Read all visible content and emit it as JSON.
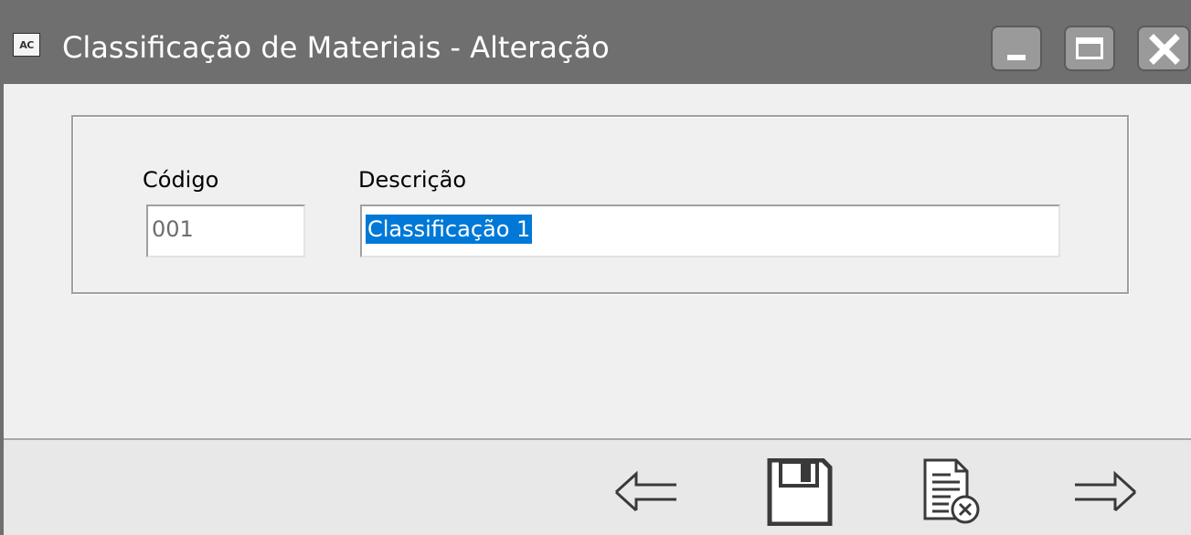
{
  "window": {
    "icon_text": "AC",
    "title": "Classificação de Materiais - Alteração"
  },
  "form": {
    "codigo_label": "Código",
    "codigo_value": "001",
    "descricao_label": "Descrição",
    "descricao_value": "Classificação 1"
  },
  "toolbar": {
    "icons": [
      "arrow-left-icon",
      "save-icon",
      "cancel-document-icon",
      "arrow-right-icon"
    ]
  },
  "colors": {
    "titlebar": "#6f6f6f",
    "selection": "#0078d7"
  }
}
